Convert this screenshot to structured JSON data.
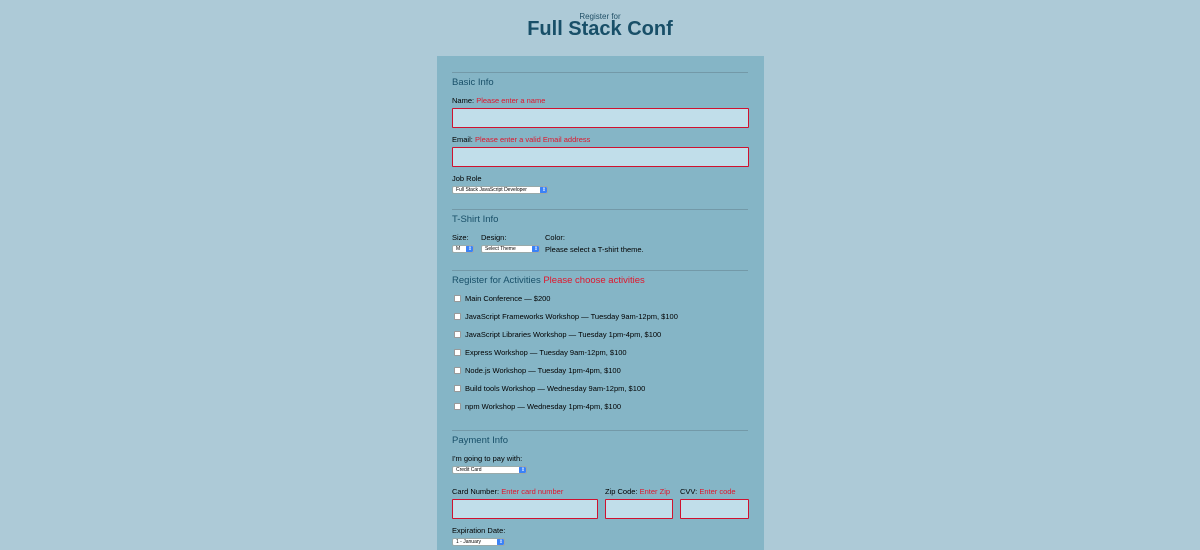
{
  "header": {
    "pre_title": "Register for",
    "title": "Full Stack Conf"
  },
  "basic_info": {
    "heading": "Basic Info",
    "name_label": "Name:",
    "name_error": "Please enter a name",
    "name_value": "",
    "email_label": "Email:",
    "email_error": "Please enter a valid Email address",
    "email_value": "",
    "job_role_label": "Job Role",
    "job_role_selected": "Full Stack JavaScript Developer"
  },
  "tshirt_info": {
    "heading": "T-Shirt Info",
    "size_label": "Size:",
    "size_selected": "M",
    "design_label": "Design:",
    "design_selected": "Select Theme",
    "color_label": "Color:",
    "color_message": "Please select a T-shirt theme."
  },
  "activities": {
    "heading": "Register for Activities",
    "error": "Please choose activities",
    "items": [
      {
        "label": "Main Conference — $200",
        "checked": false
      },
      {
        "label": "JavaScript Frameworks Workshop — Tuesday 9am-12pm, $100",
        "checked": false
      },
      {
        "label": "JavaScript Libraries Workshop — Tuesday 1pm-4pm, $100",
        "checked": false
      },
      {
        "label": "Express Workshop — Tuesday 9am-12pm, $100",
        "checked": false
      },
      {
        "label": "Node.js Workshop — Tuesday 1pm-4pm, $100",
        "checked": false
      },
      {
        "label": "Build tools Workshop — Wednesday 9am-12pm, $100",
        "checked": false
      },
      {
        "label": "npm Workshop — Wednesday 1pm-4pm, $100",
        "checked": false
      }
    ]
  },
  "payment_info": {
    "heading": "Payment Info",
    "pay_with_label": "I'm going to pay with:",
    "pay_with_selected": "Credit Card",
    "card_label": "Card Number:",
    "card_error": "Enter card number",
    "zip_label": "Zip Code:",
    "zip_error": "Enter Zip",
    "cvv_label": "CVV:",
    "cvv_error": "Enter code",
    "expiration_label": "Expiration Date:",
    "expiration_selected": "1 - January"
  },
  "colors": {
    "background": "#adcad7",
    "panel": "#85b5c6",
    "heading": "#184f68",
    "error": "#e0162c",
    "input_bg": "#c1deea",
    "select_arrow": "#3b82f6"
  }
}
